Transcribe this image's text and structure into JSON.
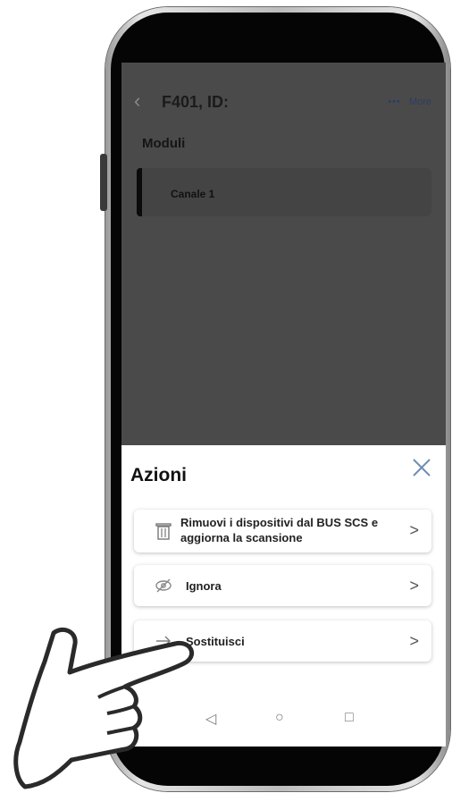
{
  "app": {
    "title": "F401, ID:",
    "back_icon": "‹",
    "more_dots": "•••",
    "more_label": "More"
  },
  "main": {
    "section_title": "Moduli",
    "channel": {
      "label": "Canale 1"
    }
  },
  "sheet": {
    "title": "Azioni",
    "items": [
      {
        "icon": "trash-icon",
        "label_line1": "Rimuovi i dispositivi dal BUS SCS e",
        "label_line2": "aggiorna la scansione"
      },
      {
        "icon": "eye-off-icon",
        "label": "Ignora"
      },
      {
        "icon": "arrow-right-icon",
        "label": "Sostituisci"
      }
    ],
    "chevron": ">"
  },
  "navbar": {
    "back": "◁",
    "home": "○",
    "recents": "□"
  },
  "colors": {
    "overlay": "#4a4a4a",
    "sheet": "#ffffff",
    "accent": "#6f8fb4"
  }
}
